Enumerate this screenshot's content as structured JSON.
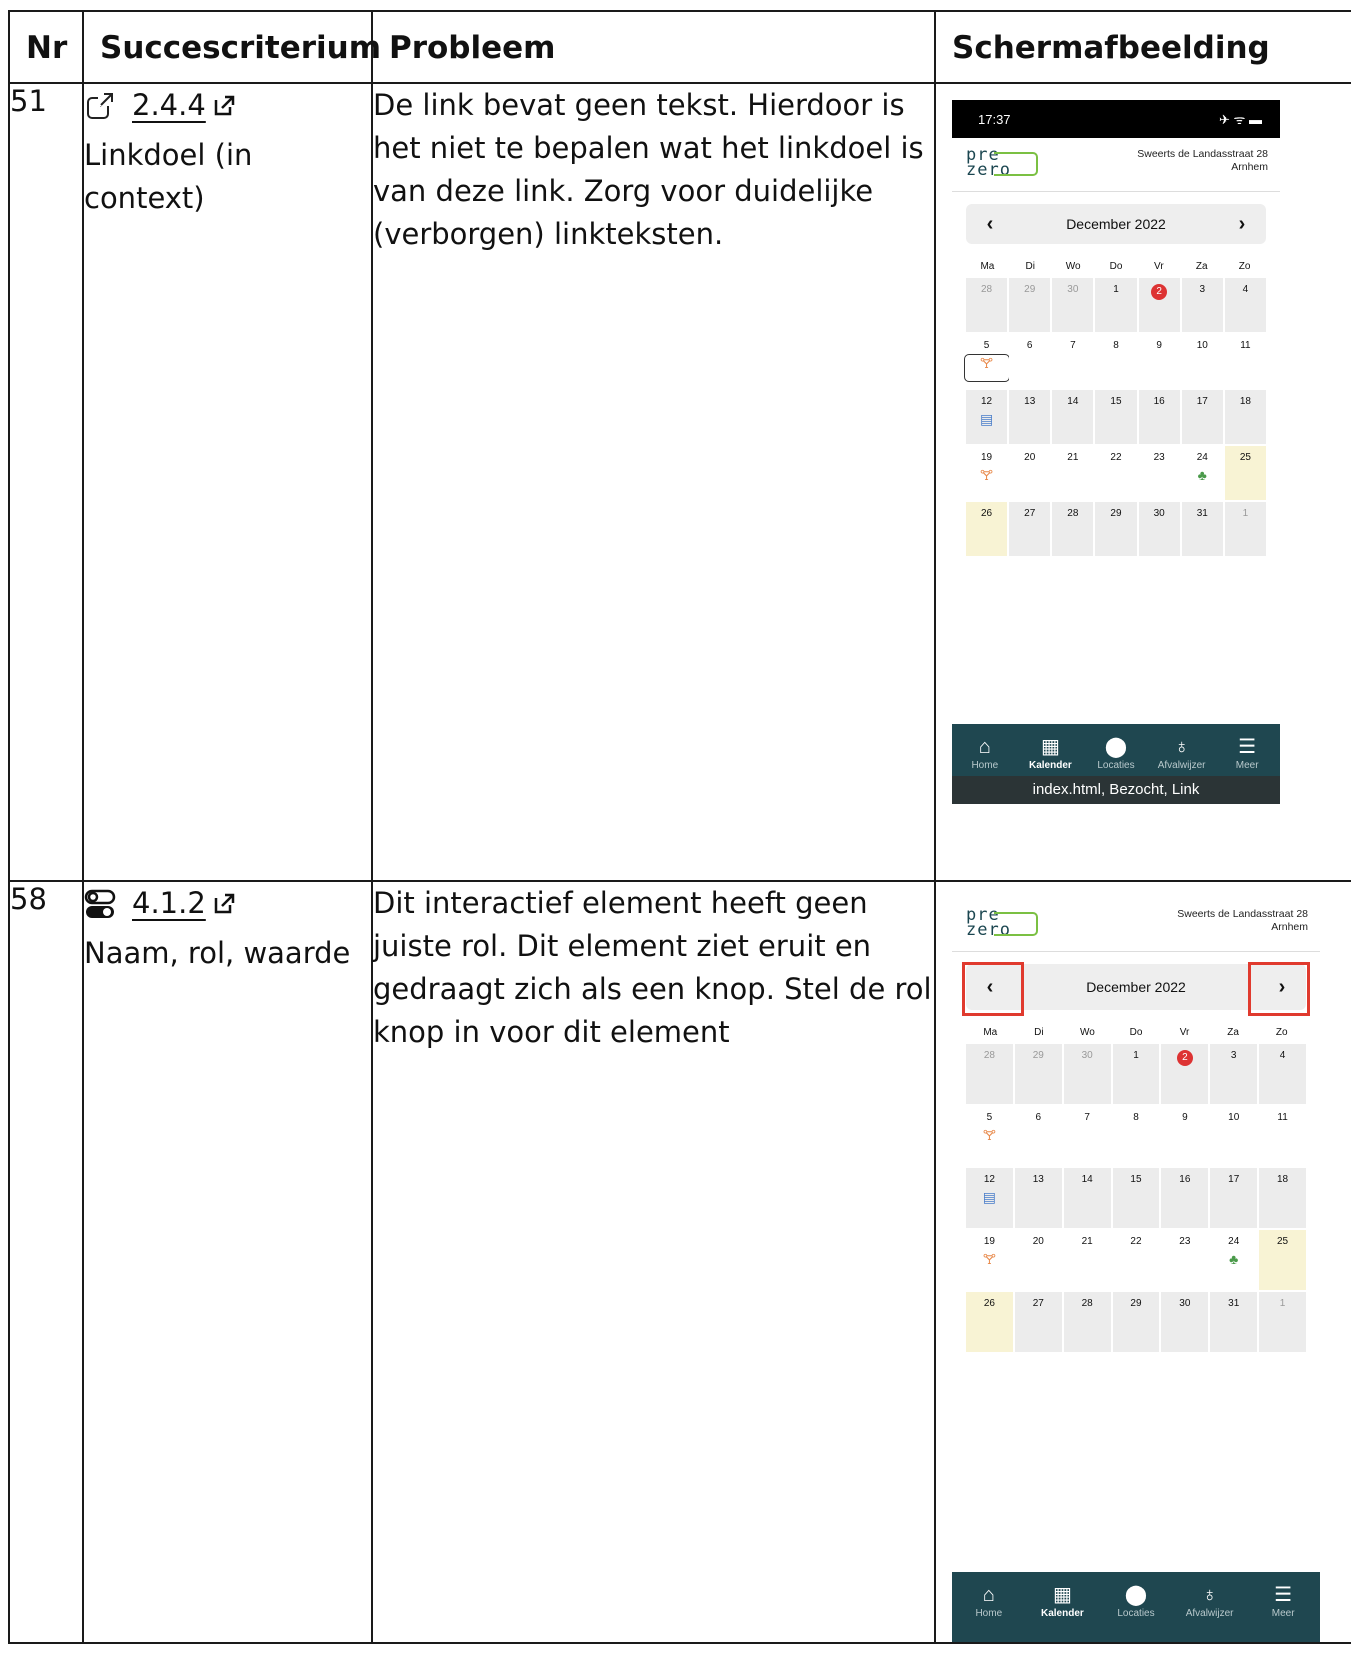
{
  "headers": {
    "nr": "Nr",
    "criterium": "Succescriterium",
    "probleem": "Probleem",
    "screenshot": "Schermafbeelding"
  },
  "rows": [
    {
      "nr": "51",
      "criterium_number": "2.4.4",
      "criterium_name": "Linkdoel (in context)",
      "criterium_icon": "external-link-icon",
      "probleem": "De link bevat geen tekst. Hierdoor is het niet te bepalen wat het linkdoel is van deze link. Zorg voor duidelijke (verborgen) linkteksten.",
      "phone": {
        "time": "17:37",
        "status_icons": "✈ ᯤ ▬",
        "address_line1": "Sweerts de Landasstraat 28",
        "address_line2": "Arnhem",
        "month": "December 2022",
        "voiceover": "index.html, Bezocht, Link"
      }
    },
    {
      "nr": "58",
      "criterium_number": "4.1.2",
      "criterium_name": "Naam, rol, waarde",
      "criterium_icon": "toggle-icon",
      "probleem": "Dit interactief element heeft geen juiste rol. Dit element ziet eruit en gedraagt zich als een knop. Stel de rol knop in voor dit element",
      "phone": {
        "address_line1": "Sweerts de Landasstraat 28",
        "address_line2": "Arnhem",
        "month": "December 2022"
      }
    }
  ],
  "logo": {
    "line1": "pre",
    "line2": "zero"
  },
  "weekdays": [
    "Ma",
    "Di",
    "Wo",
    "Do",
    "Vr",
    "Za",
    "Zo"
  ],
  "weeks": [
    [
      {
        "d": "28",
        "s": "dim"
      },
      {
        "d": "29",
        "s": "dim"
      },
      {
        "d": "30",
        "s": "dim"
      },
      {
        "d": "1"
      },
      {
        "d": "2",
        "red": true
      },
      {
        "d": "3"
      },
      {
        "d": "4"
      }
    ],
    [
      {
        "d": "5",
        "s": "white",
        "icon": "orange"
      },
      {
        "d": "6",
        "s": "white"
      },
      {
        "d": "7",
        "s": "white"
      },
      {
        "d": "8",
        "s": "white"
      },
      {
        "d": "9",
        "s": "white"
      },
      {
        "d": "10",
        "s": "white"
      },
      {
        "d": "11",
        "s": "white"
      }
    ],
    [
      {
        "d": "12",
        "icon": "blue"
      },
      {
        "d": "13"
      },
      {
        "d": "14"
      },
      {
        "d": "15"
      },
      {
        "d": "16"
      },
      {
        "d": "17"
      },
      {
        "d": "18"
      }
    ],
    [
      {
        "d": "19",
        "s": "white",
        "icon": "orange"
      },
      {
        "d": "20",
        "s": "white"
      },
      {
        "d": "21",
        "s": "white"
      },
      {
        "d": "22",
        "s": "white"
      },
      {
        "d": "23",
        "s": "white"
      },
      {
        "d": "24",
        "s": "white",
        "icon": "green"
      },
      {
        "d": "25",
        "s": "yellow"
      }
    ],
    [
      {
        "d": "26",
        "s": "yellow"
      },
      {
        "d": "27"
      },
      {
        "d": "28"
      },
      {
        "d": "29"
      },
      {
        "d": "30"
      },
      {
        "d": "31"
      },
      {
        "d": "1",
        "s": "dim"
      }
    ]
  ],
  "tabs": [
    {
      "label": "Home",
      "icon": "home-icon",
      "glyph": "⌂"
    },
    {
      "label": "Kalender",
      "icon": "calendar-icon",
      "glyph": "▦",
      "active": true
    },
    {
      "label": "Locaties",
      "icon": "location-pin-icon",
      "glyph": "⬤"
    },
    {
      "label": "Afvalwijzer",
      "icon": "lightbulb-icon",
      "glyph": "♁"
    },
    {
      "label": "Meer",
      "icon": "list-icon",
      "glyph": "☰"
    }
  ],
  "waste_icons": {
    "orange": "🝖",
    "blue": "▤",
    "green": "♣"
  },
  "colors": {
    "red_highlight": "#e03a2e",
    "tabbar": "#1f4750",
    "logo_green": "#7bc043"
  }
}
